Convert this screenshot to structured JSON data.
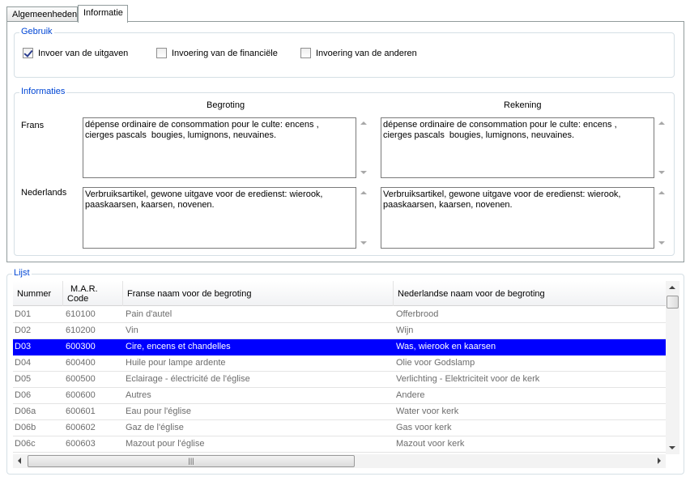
{
  "tabs": [
    {
      "label": "Algemeenheden",
      "active": false
    },
    {
      "label": "Informatie",
      "active": true
    }
  ],
  "gebruik": {
    "legend": "Gebruik",
    "checkboxes": [
      {
        "label": "Invoer van de uitgaven",
        "checked": true
      },
      {
        "label": "Invoering van de financiële",
        "checked": false
      },
      {
        "label": "Invoering van de anderen",
        "checked": false
      }
    ]
  },
  "informaties": {
    "legend": "Informaties",
    "col_begroting": "Begroting",
    "col_rekening": "Rekening",
    "row_frans": "Frans",
    "row_nederlands": "Nederlands",
    "frans_begroting": "dépense ordinaire de consommation pour le culte: encens , cierges pascals  bougies, lumignons, neuvaines.",
    "frans_rekening": "dépense ordinaire de consommation pour le culte: encens , cierges pascals  bougies, lumignons, neuvaines.",
    "nederlands_begroting": "Verbruiksartikel, gewone uitgave voor de eredienst: wierook, paaskaarsen, kaarsen, novenen.",
    "nederlands_rekening": "Verbruiksartikel, gewone uitgave voor de eredienst: wierook, paaskaarsen, kaarsen, novenen."
  },
  "lijst": {
    "legend": "Lijst",
    "columns": {
      "nummer": "Nummer",
      "mar_code_line1": "M.A.R.",
      "mar_code_line2": "Code",
      "franse_naam": "Franse naam voor de begroting",
      "nederlandse_naam": "Nederlandse naam voor de begroting"
    },
    "rows": [
      {
        "nummer": "D01",
        "code": "610100",
        "fr": "Pain d'autel",
        "nl": "Offerbrood",
        "selected": false
      },
      {
        "nummer": "D02",
        "code": "610200",
        "fr": "Vin",
        "nl": "Wijn",
        "selected": false
      },
      {
        "nummer": "D03",
        "code": "600300",
        "fr": "Cire, encens et chandelles",
        "nl": "Was, wierook en kaarsen",
        "selected": true
      },
      {
        "nummer": "D04",
        "code": "600400",
        "fr": "Huile pour lampe ardente",
        "nl": "Olie voor Godslamp",
        "selected": false
      },
      {
        "nummer": "D05",
        "code": "600500",
        "fr": "Eclairage - électricité de l'église",
        "nl": "Verlichting - Elektriciteit voor de  kerk",
        "selected": false
      },
      {
        "nummer": "D06",
        "code": "600600",
        "fr": "Autres",
        "nl": "Andere",
        "selected": false
      },
      {
        "nummer": "D06a",
        "code": "600601",
        "fr": "Eau pour l'église",
        "nl": "Water voor kerk",
        "selected": false
      },
      {
        "nummer": "D06b",
        "code": "600602",
        "fr": "Gaz de l'église",
        "nl": "Gas voor kerk",
        "selected": false
      },
      {
        "nummer": "D06c",
        "code": "600603",
        "fr": "Mazout pour l'église",
        "nl": "Mazout voor kerk",
        "selected": false
      }
    ]
  },
  "colors": {
    "legend_text": "#0046d5",
    "selection": "#0000ff"
  }
}
